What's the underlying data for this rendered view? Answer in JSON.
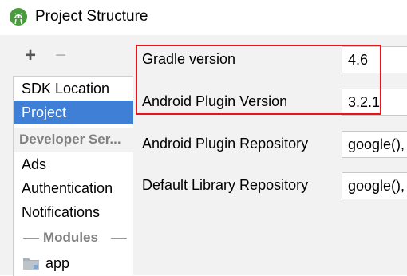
{
  "window": {
    "title": "Project Structure"
  },
  "toolbar": {
    "add_label": "+",
    "remove_label": "−"
  },
  "sidebar": {
    "items": [
      {
        "label": "SDK Location"
      },
      {
        "label": "Project"
      }
    ],
    "developer_header": "Developer Ser...",
    "developer_items": [
      {
        "label": "Ads"
      },
      {
        "label": "Authentication"
      },
      {
        "label": "Notifications"
      }
    ],
    "modules_header": "Modules",
    "modules": [
      {
        "label": "app"
      }
    ]
  },
  "project_settings": {
    "gradle_version": {
      "label": "Gradle version",
      "value": "4.6"
    },
    "android_plugin_version": {
      "label": "Android Plugin Version",
      "value": "3.2.1"
    },
    "android_plugin_repository": {
      "label": "Android Plugin Repository",
      "value": "google(),"
    },
    "default_library_repository": {
      "label": "Default Library Repository",
      "value": "google(),"
    }
  },
  "icons": {
    "app": "android-studio-icon",
    "module": "folder-icon"
  },
  "colors": {
    "selection": "#3f7fd6",
    "highlight": "#e8141c",
    "panel_bg": "#f2f2f2"
  }
}
